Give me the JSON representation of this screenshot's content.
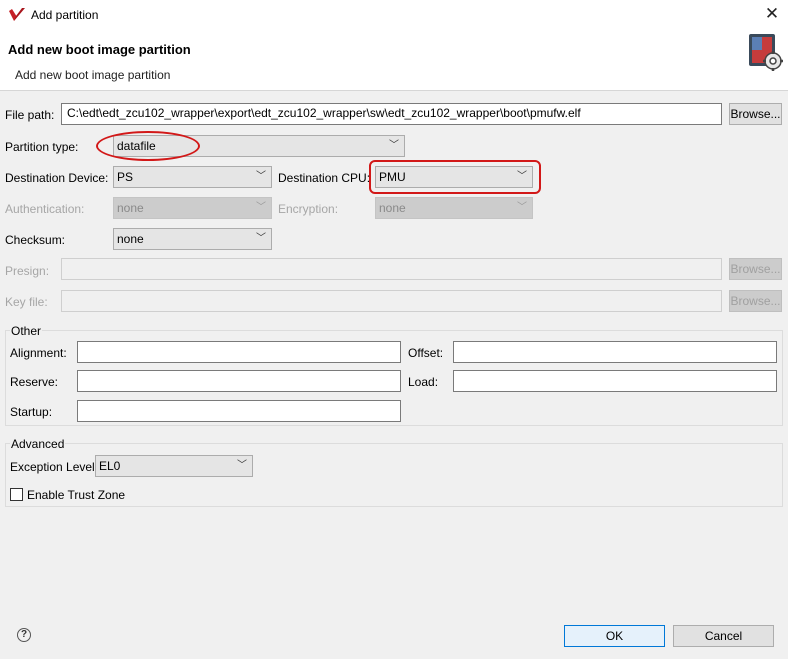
{
  "window": {
    "title": "Add partition"
  },
  "banner": {
    "title": "Add new boot image partition",
    "subtitle": "Add new boot image partition"
  },
  "file_path": {
    "label": "File path:",
    "value": "C:\\edt\\edt_zcu102_wrapper\\export\\edt_zcu102_wrapper\\sw\\edt_zcu102_wrapper\\boot\\pmufw.elf",
    "browse_label": "Browse..."
  },
  "partition_type": {
    "label": "Partition type:",
    "value": "datafile"
  },
  "destination_device": {
    "label": "Destination Device:",
    "value": "PS"
  },
  "destination_cpu": {
    "label": "Destination CPU:",
    "value": "PMU"
  },
  "authentication": {
    "label": "Authentication:",
    "value": "none"
  },
  "encryption": {
    "label": "Encryption:",
    "value": "none"
  },
  "checksum": {
    "label": "Checksum:",
    "value": "none"
  },
  "presign": {
    "label": "Presign:",
    "value": "",
    "browse_label": "Browse..."
  },
  "key_file": {
    "label": "Key file:",
    "value": "",
    "browse_label": "Browse..."
  },
  "other": {
    "title": "Other",
    "alignment_label": "Alignment:",
    "alignment_value": "",
    "offset_label": "Offset:",
    "offset_value": "",
    "reserve_label": "Reserve:",
    "reserve_value": "",
    "load_label": "Load:",
    "load_value": "",
    "startup_label": "Startup:",
    "startup_value": ""
  },
  "advanced": {
    "title": "Advanced",
    "exception_level_label": "Exception Level",
    "exception_level_value": "EL0",
    "trust_zone_label": "Enable Trust Zone",
    "trust_zone_checked": false
  },
  "footer": {
    "help_glyph": "?",
    "ok_label": "OK",
    "cancel_label": "Cancel"
  },
  "colors": {
    "highlight": "#d21818",
    "default_button_border": "#0078d7"
  },
  "icons": {
    "app": "vivado-logo-icon",
    "banner": "boot-image-gear-icon",
    "close": "close-icon",
    "help": "help-icon"
  }
}
